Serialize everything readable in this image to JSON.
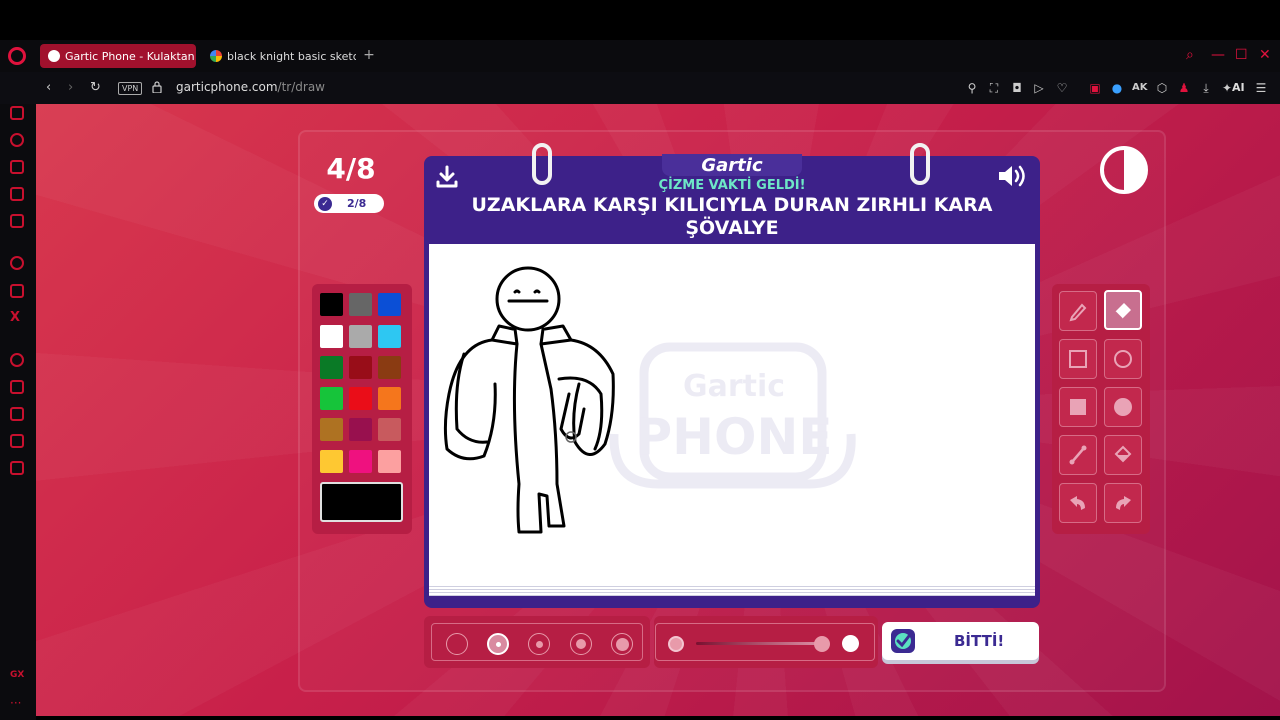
{
  "browser": {
    "tabs": [
      {
        "label": "Gartic Phone - Kulaktan Ku"
      },
      {
        "label": "black knight basic sketch"
      }
    ],
    "url_host": "garticphone.com",
    "url_path": "/tr/draw",
    "vpn_label": "VPN",
    "ai_label": "AI",
    "gx_label": "GX"
  },
  "game": {
    "round": "4/8",
    "players_done": "2/8",
    "brand": "Gartic",
    "subtitle": "ÇİZME VAKTİ GELDİ!",
    "prompt": "UZAKLARA KARŞI KILICIYLA DURAN ZIRHLI KARA ŞÖVALYE",
    "done_button": "BİTTİ!",
    "watermark_top": "Gartic",
    "watermark_bottom": "PHONE"
  },
  "palette": {
    "colors": [
      "#000000",
      "#666666",
      "#0b4fd6",
      "#ffffff",
      "#aaaaaa",
      "#2ec7f2",
      "#0a7a26",
      "#980d18",
      "#8a3b12",
      "#16c43a",
      "#ea0d18",
      "#f5761c",
      "#ae7222",
      "#98104e",
      "#c85a5e",
      "#fec832",
      "#ef117f",
      "#fca0a0"
    ],
    "selected_color": "#000000"
  },
  "tools": {
    "selected": "eraser"
  }
}
